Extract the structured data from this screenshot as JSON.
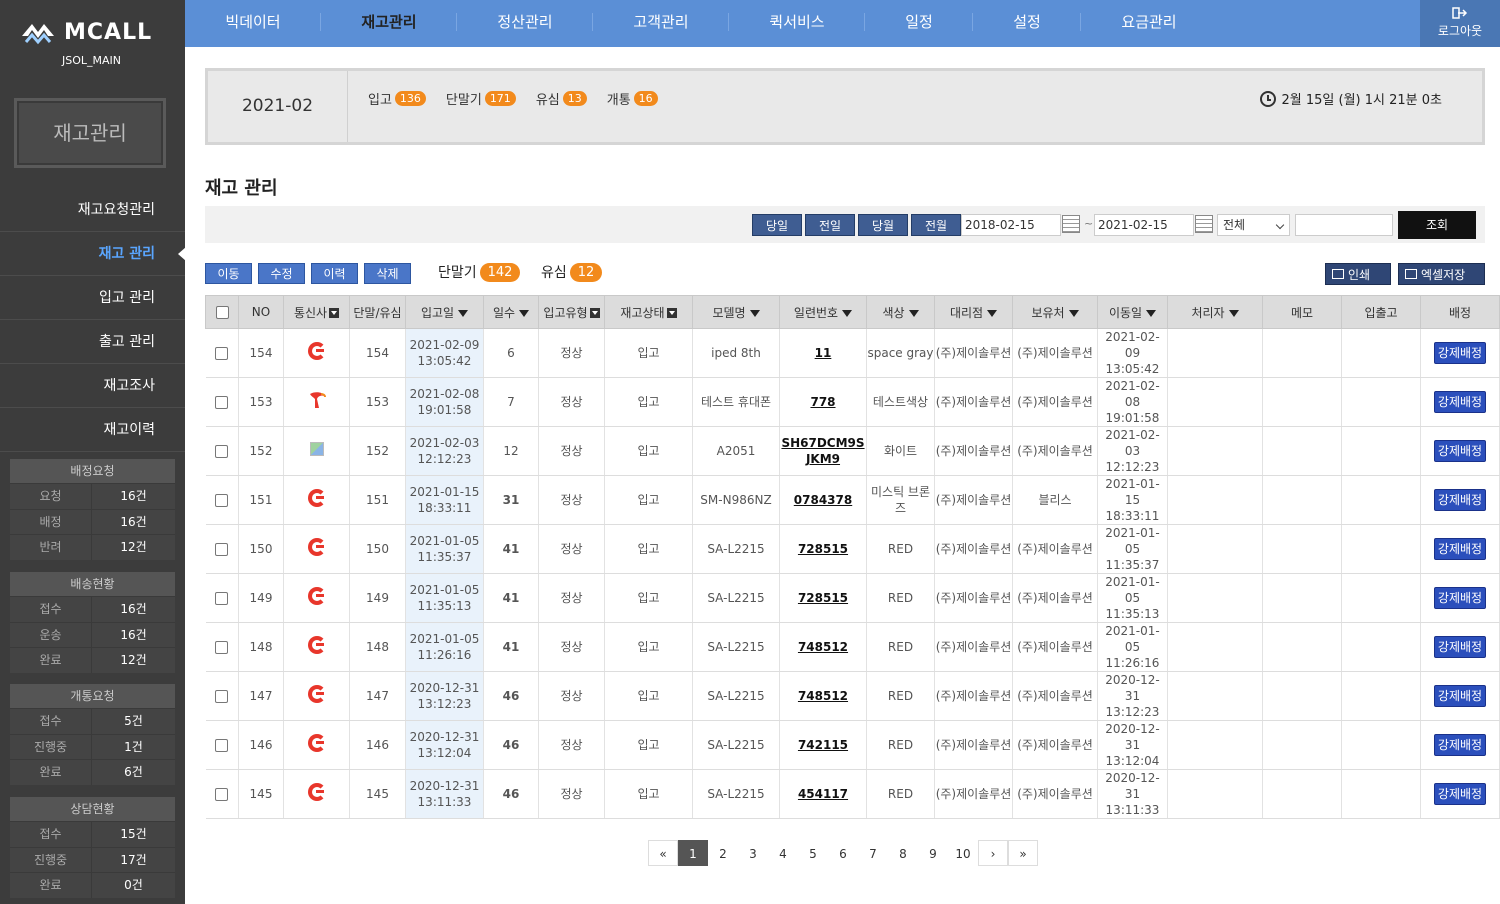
{
  "sidebar": {
    "brand": "MCALL",
    "account": "JSOL_MAIN",
    "section_title": "재고관리",
    "menu": [
      {
        "label": "재고요청관리",
        "active": false
      },
      {
        "label": "재고 관리",
        "active": true
      },
      {
        "label": "입고 관리",
        "active": false
      },
      {
        "label": "출고 관리",
        "active": false
      },
      {
        "label": "재고조사",
        "active": false
      },
      {
        "label": "재고이력",
        "active": false
      }
    ],
    "boxes": [
      {
        "title": "배정요청",
        "rows": [
          {
            "k": "요청",
            "v": "16건"
          },
          {
            "k": "배정",
            "v": "16건"
          },
          {
            "k": "반려",
            "v": "12건"
          }
        ]
      },
      {
        "title": "배송현황",
        "rows": [
          {
            "k": "접수",
            "v": "16건"
          },
          {
            "k": "운송",
            "v": "16건"
          },
          {
            "k": "완료",
            "v": "12건"
          }
        ]
      },
      {
        "title": "개통요청",
        "rows": [
          {
            "k": "접수",
            "v": "5건"
          },
          {
            "k": "진행중",
            "v": "1건"
          },
          {
            "k": "완료",
            "v": "6건"
          }
        ]
      },
      {
        "title": "상담현황",
        "rows": [
          {
            "k": "접수",
            "v": "15건"
          },
          {
            "k": "진행중",
            "v": "17건"
          },
          {
            "k": "완료",
            "v": "0건"
          }
        ]
      }
    ]
  },
  "topnav": {
    "items": [
      "빅데이터",
      "재고관리",
      "정산관리",
      "고객관리",
      "퀵서비스",
      "일정",
      "설정",
      "요금관리"
    ],
    "active_index": 1,
    "logout_label": "로그아웃"
  },
  "summary": {
    "month": "2021-02",
    "counts": [
      {
        "label": "입고",
        "value": "136"
      },
      {
        "label": "단말기",
        "value": "171"
      },
      {
        "label": "유심",
        "value": "13"
      },
      {
        "label": "개통",
        "value": "16"
      }
    ],
    "datetime": "2월 15일 (월) 1시 21분 0초"
  },
  "page_title": "재고 관리",
  "filter": {
    "quick": [
      "당일",
      "전일",
      "당월",
      "전월"
    ],
    "date_from": "2018-02-15",
    "tilde": "~",
    "date_to": "2021-02-15",
    "select_value": "전체",
    "search_value": "",
    "search_label": "조회"
  },
  "actions": {
    "buttons": [
      "이동",
      "수정",
      "이력",
      "삭제"
    ],
    "stats": [
      {
        "label": "단말기",
        "value": "142"
      },
      {
        "label": "유심",
        "value": "12"
      }
    ],
    "print_label": "인쇄",
    "excel_label": "엑셀저장"
  },
  "table": {
    "headers": [
      "NO",
      "통신사",
      "단말/유심",
      "입고일",
      "일수",
      "입고유형",
      "재고상태",
      "모델명",
      "일련번호",
      "색상",
      "대리점",
      "보유처",
      "이동일",
      "처리자",
      "메모",
      "입출고",
      "배정"
    ],
    "assign_label": "강제배정",
    "rows": [
      {
        "no": "154",
        "carrier": "kt",
        "unit": "154",
        "in_date": "2021-02-09",
        "in_time": "13:05:42",
        "days": "6",
        "days_red": false,
        "in_type": "정상",
        "status": "입고",
        "model": "iped 8th",
        "serial": "11",
        "color": "space gray",
        "agency": "(주)제이솔루션",
        "holder": "(주)제이솔루션",
        "move_date": "2021-02-09",
        "move_time": "13:05:42"
      },
      {
        "no": "153",
        "carrier": "skt",
        "unit": "153",
        "in_date": "2021-02-08",
        "in_time": "19:01:58",
        "days": "7",
        "days_red": false,
        "in_type": "정상",
        "status": "입고",
        "model": "테스트 휴대폰",
        "serial": "778",
        "color": "테스트색상",
        "agency": "(주)제이솔루션",
        "holder": "(주)제이솔루션",
        "move_date": "2021-02-08",
        "move_time": "19:01:58"
      },
      {
        "no": "152",
        "carrier": "broken",
        "unit": "152",
        "in_date": "2021-02-03",
        "in_time": "12:12:23",
        "days": "12",
        "days_red": false,
        "in_type": "정상",
        "status": "입고",
        "model": "A2051",
        "serial": "SH67DCM9SJKM9",
        "color": "화이트",
        "agency": "(주)제이솔루션",
        "holder": "(주)제이솔루션",
        "move_date": "2021-02-03",
        "move_time": "12:12:23"
      },
      {
        "no": "151",
        "carrier": "kt",
        "unit": "151",
        "in_date": "2021-01-15",
        "in_time": "18:33:11",
        "days": "31",
        "days_red": true,
        "in_type": "정상",
        "status": "입고",
        "model": "SM-N986NZ",
        "serial": "0784378",
        "color": "미스틱 브론즈",
        "agency": "(주)제이솔루션",
        "holder": "블리스",
        "move_date": "2021-01-15",
        "move_time": "18:33:11"
      },
      {
        "no": "150",
        "carrier": "kt",
        "unit": "150",
        "in_date": "2021-01-05",
        "in_time": "11:35:37",
        "days": "41",
        "days_red": true,
        "in_type": "정상",
        "status": "입고",
        "model": "SA-L2215",
        "serial": "728515",
        "color": "RED",
        "agency": "(주)제이솔루션",
        "holder": "(주)제이솔루션",
        "move_date": "2021-01-05",
        "move_time": "11:35:37"
      },
      {
        "no": "149",
        "carrier": "kt",
        "unit": "149",
        "in_date": "2021-01-05",
        "in_time": "11:35:13",
        "days": "41",
        "days_red": true,
        "in_type": "정상",
        "status": "입고",
        "model": "SA-L2215",
        "serial": "728515",
        "color": "RED",
        "agency": "(주)제이솔루션",
        "holder": "(주)제이솔루션",
        "move_date": "2021-01-05",
        "move_time": "11:35:13"
      },
      {
        "no": "148",
        "carrier": "kt",
        "unit": "148",
        "in_date": "2021-01-05",
        "in_time": "11:26:16",
        "days": "41",
        "days_red": true,
        "in_type": "정상",
        "status": "입고",
        "model": "SA-L2215",
        "serial": "748512",
        "color": "RED",
        "agency": "(주)제이솔루션",
        "holder": "(주)제이솔루션",
        "move_date": "2021-01-05",
        "move_time": "11:26:16"
      },
      {
        "no": "147",
        "carrier": "kt",
        "unit": "147",
        "in_date": "2020-12-31",
        "in_time": "13:12:23",
        "days": "46",
        "days_red": true,
        "in_type": "정상",
        "status": "입고",
        "model": "SA-L2215",
        "serial": "748512",
        "color": "RED",
        "agency": "(주)제이솔루션",
        "holder": "(주)제이솔루션",
        "move_date": "2020-12-31",
        "move_time": "13:12:23"
      },
      {
        "no": "146",
        "carrier": "kt",
        "unit": "146",
        "in_date": "2020-12-31",
        "in_time": "13:12:04",
        "days": "46",
        "days_red": true,
        "in_type": "정상",
        "status": "입고",
        "model": "SA-L2215",
        "serial": "742115",
        "color": "RED",
        "agency": "(주)제이솔루션",
        "holder": "(주)제이솔루션",
        "move_date": "2020-12-31",
        "move_time": "13:12:04"
      },
      {
        "no": "145",
        "carrier": "kt",
        "unit": "145",
        "in_date": "2020-12-31",
        "in_time": "13:11:33",
        "days": "46",
        "days_red": true,
        "in_type": "정상",
        "status": "입고",
        "model": "SA-L2215",
        "serial": "454117",
        "color": "RED",
        "agency": "(주)제이솔루션",
        "holder": "(주)제이솔루션",
        "move_date": "2020-12-31",
        "move_time": "13:11:33"
      }
    ]
  },
  "pager": {
    "first": "«",
    "prev": "‹",
    "pages": [
      "1",
      "2",
      "3",
      "4",
      "5",
      "6",
      "7",
      "8",
      "9",
      "10"
    ],
    "current": "1",
    "next": "›",
    "last": "»"
  },
  "colors": {
    "accent_blue": "#5b8fd6",
    "badge_orange": "#f28a1c",
    "sidebar_bg": "#3c3c3c",
    "kt_red": "#e8362b",
    "assign_blue": "#2b4fbc"
  }
}
